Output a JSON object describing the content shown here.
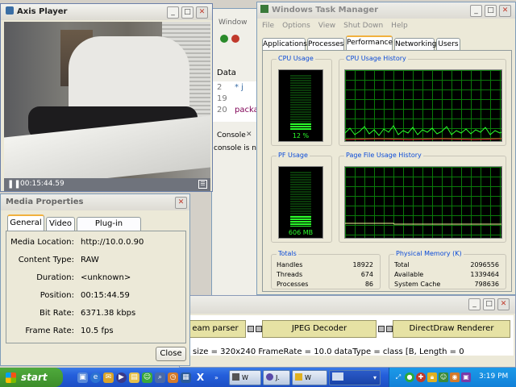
{
  "axis_player": {
    "title": "Axis Player",
    "timestamp": "00:15:44.59"
  },
  "ide": {
    "menu_window": "Window",
    "data_tab": "Data",
    "line_numbers": [
      "2",
      "19",
      "20"
    ],
    "code_fragments": [
      "* j",
      "packa"
    ],
    "console_tab": "Console",
    "console_text": "console is not a"
  },
  "task_manager": {
    "title": "Windows Task Manager",
    "menu": [
      "File",
      "Options",
      "View",
      "Shut Down",
      "Help"
    ],
    "tabs": [
      "Applications",
      "Processes",
      "Performance",
      "Networking",
      "Users"
    ],
    "selected_tab": "Performance",
    "cpu_usage_label": "CPU Usage",
    "cpu_usage_value": "12 %",
    "cpu_usage_fraction": 0.12,
    "cpu_history_label": "CPU Usage History",
    "pf_usage_label": "PF Usage",
    "pf_usage_value": "606 MB",
    "pf_usage_fraction": 0.18,
    "pf_history_label": "Page File Usage History",
    "totals": {
      "label": "Totals",
      "rows": [
        {
          "label": "Handles",
          "value": "18922"
        },
        {
          "label": "Threads",
          "value": "674"
        },
        {
          "label": "Processes",
          "value": "86"
        }
      ]
    },
    "physical_memory": {
      "label": "Physical Memory (K)",
      "rows": [
        {
          "label": "Total",
          "value": "2096556"
        },
        {
          "label": "Available",
          "value": "1339464"
        },
        {
          "label": "System Cache",
          "value": "798636"
        }
      ]
    }
  },
  "media_properties": {
    "title": "Media Properties",
    "tabs": [
      "General",
      "Video",
      "Plug-in Settings"
    ],
    "selected_tab": "General",
    "fields": [
      {
        "label": "Media Location:",
        "value": "http://10.0.0.90"
      },
      {
        "label": "Content Type:",
        "value": "RAW"
      },
      {
        "label": "Duration:",
        "value": "<unknown>"
      },
      {
        "label": "Position:",
        "value": "00:15:44.59"
      },
      {
        "label": "Bit Rate:",
        "value": "6371.38 kbps"
      },
      {
        "label": "Frame Rate:",
        "value": "10.5 fps"
      }
    ],
    "close_label": "Close"
  },
  "graph_window": {
    "filters": [
      "eam parser",
      "JPEG Decoder",
      "DirectDraw Renderer"
    ],
    "status": "size = 320x240 FrameRate = 10.0 dataType = class [B, Length = 0"
  },
  "taskbar": {
    "start_label": "start",
    "buttons": [
      "W",
      "J.",
      "W"
    ],
    "clock": "3:19 PM"
  },
  "colors": {
    "graph_line": "#2bff2b",
    "graph_grid": "#0a7a0a",
    "taskbar_blue": "#245edb",
    "start_green": "#3c8d2a"
  }
}
